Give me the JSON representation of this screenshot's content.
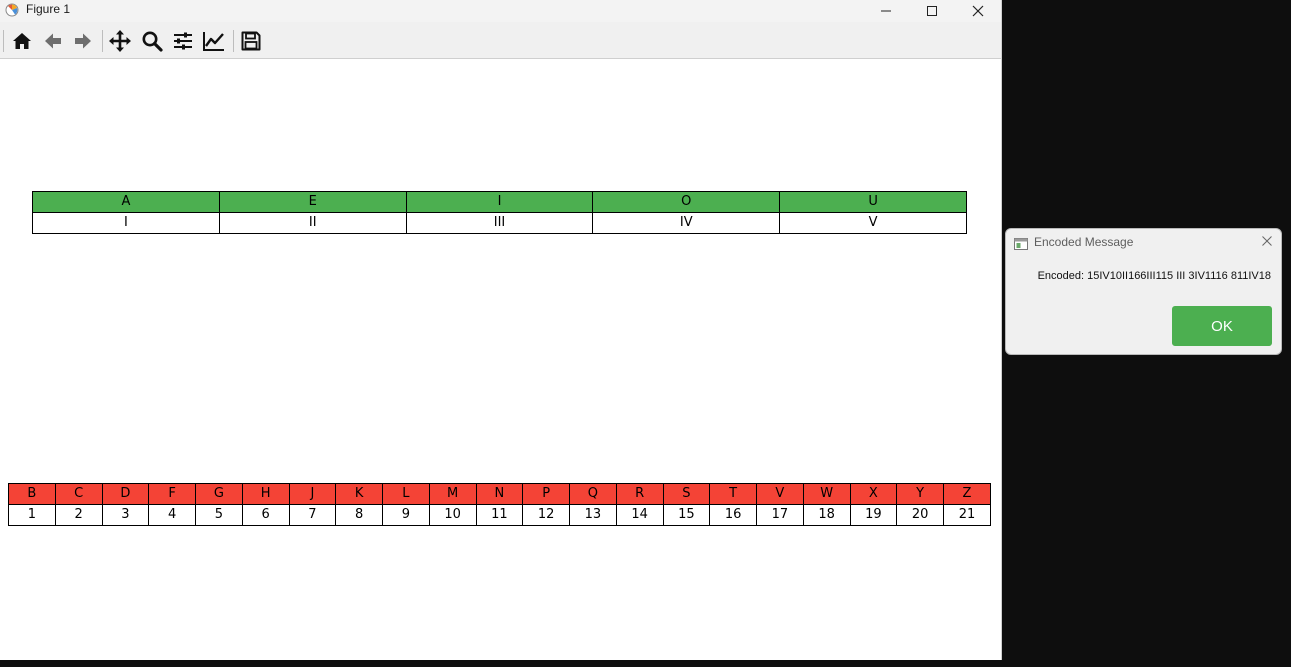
{
  "window": {
    "title": "Figure 1"
  },
  "toolbar": {
    "buttons": [
      {
        "icon": "home-icon",
        "tooltip": "Home"
      },
      {
        "icon": "back-arrow-icon",
        "tooltip": "Back"
      },
      {
        "icon": "forward-arrow-icon",
        "tooltip": "Forward"
      },
      {
        "icon": "pan-icon",
        "tooltip": "Pan"
      },
      {
        "icon": "zoom-icon",
        "tooltip": "Zoom"
      },
      {
        "icon": "subplots-icon",
        "tooltip": "Subplots"
      },
      {
        "icon": "edit-axis-icon",
        "tooltip": "Customize"
      },
      {
        "icon": "save-icon",
        "tooltip": "Save"
      }
    ]
  },
  "vowel_table": {
    "header_color": "#4caf50",
    "headers": [
      "A",
      "E",
      "I",
      "O",
      "U"
    ],
    "values": [
      "I",
      "II",
      "III",
      "IV",
      "V"
    ]
  },
  "consonant_table": {
    "header_color": "#f44336",
    "headers": [
      "B",
      "C",
      "D",
      "F",
      "G",
      "H",
      "J",
      "K",
      "L",
      "M",
      "N",
      "P",
      "Q",
      "R",
      "S",
      "T",
      "V",
      "W",
      "X",
      "Y",
      "Z"
    ],
    "values": [
      "1",
      "2",
      "3",
      "4",
      "5",
      "6",
      "7",
      "8",
      "9",
      "10",
      "11",
      "12",
      "13",
      "14",
      "15",
      "16",
      "17",
      "18",
      "19",
      "20",
      "21"
    ]
  },
  "dialog": {
    "title": "Encoded Message",
    "message": "Encoded: 15IV10II166III115 III 3IV1116 811IV18",
    "ok_label": "OK",
    "ok_color": "#4caf50"
  }
}
